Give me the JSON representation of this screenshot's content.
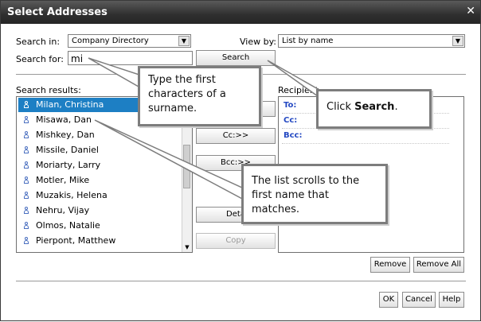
{
  "window": {
    "title": "Select Addresses",
    "close_glyph": "✕"
  },
  "search": {
    "search_in_label": "Search in:",
    "search_in_value": "Company Directory",
    "search_for_label": "Search for:",
    "search_for_value": "mi",
    "view_by_label": "View by:",
    "view_by_value": "List by name",
    "search_button": "Search"
  },
  "results": {
    "label": "Search results:",
    "items": [
      {
        "name": "Milan, Christina",
        "selected": true
      },
      {
        "name": "Misawa, Dan"
      },
      {
        "name": "Mishkey, Dan"
      },
      {
        "name": "Missile, Daniel"
      },
      {
        "name": "Moriarty, Larry"
      },
      {
        "name": "Motler, Mike"
      },
      {
        "name": "Muzakis, Helena"
      },
      {
        "name": "Nehru, Vijay"
      },
      {
        "name": "Olmos, Natalie"
      },
      {
        "name": "Pierpont, Matthew"
      }
    ]
  },
  "middle_buttons": {
    "cc": "Cc:>>",
    "bcc": "Bcc:>>",
    "details": "Deta",
    "copy": "Copy"
  },
  "recipients": {
    "label": "Recipient",
    "to": "To:",
    "cc": "Cc:",
    "bcc": "Bcc:"
  },
  "bottom": {
    "remove": "Remove",
    "remove_all": "Remove All",
    "ok": "OK",
    "cancel": "Cancel",
    "help": "Help"
  },
  "callouts": {
    "type_first": "Type the first characters of a surname.",
    "click_search_prefix": "Click ",
    "click_search_bold": "Search",
    "click_search_suffix": ".",
    "list_scrolls": "The list scrolls to the first name that matches."
  },
  "colors": {
    "selection": "#1d7fc4",
    "recipient_label": "#2348c2",
    "titlebar": "#2f2f2f"
  }
}
